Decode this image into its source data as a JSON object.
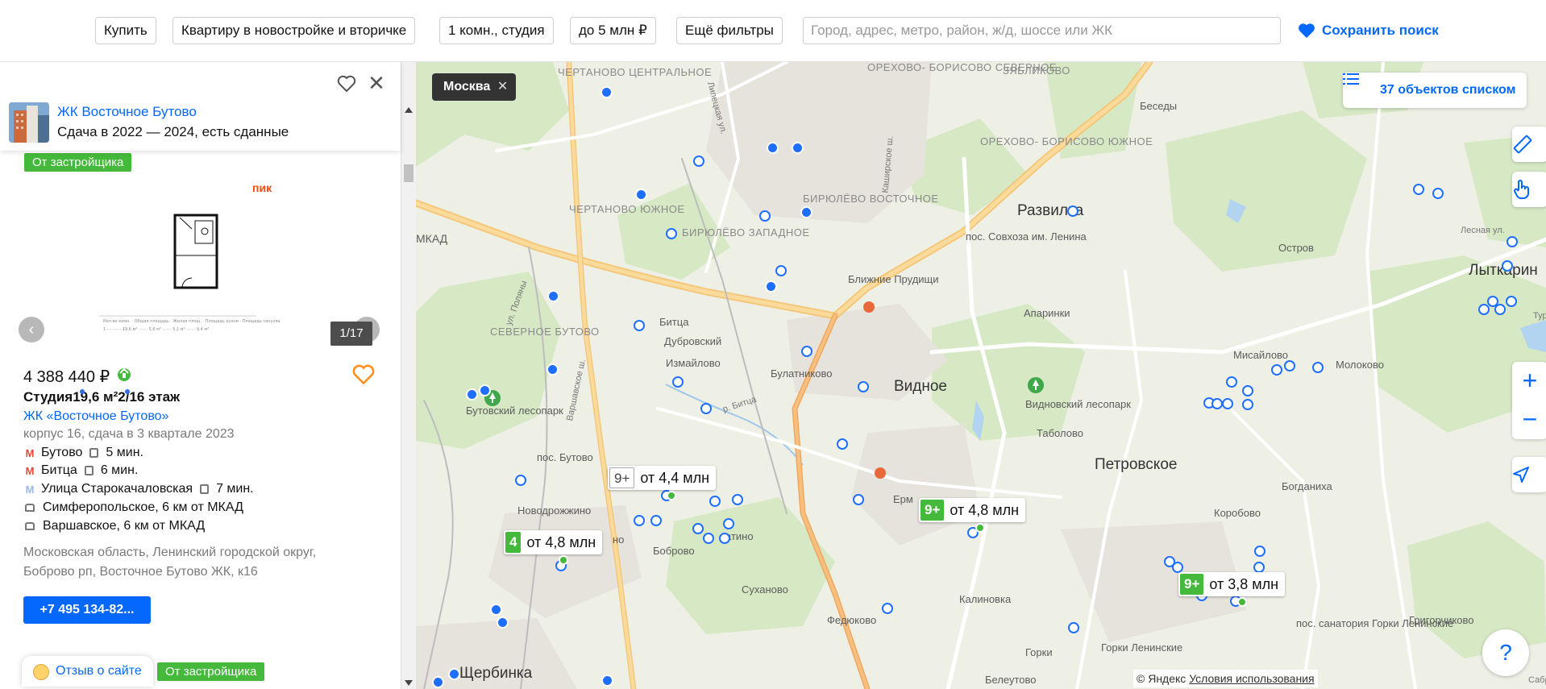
{
  "filters": {
    "buy": "Купить",
    "type": "Квартиру в новостройке и вторичке",
    "rooms": "1 комн., студия",
    "price": "до 5 млн ₽",
    "more": "Ещё фильтры",
    "search_placeholder": "Город, адрес, метро, район, ж/д, шоссе или ЖК",
    "save_search": "Сохранить поиск"
  },
  "complex": {
    "name": "ЖК Восточное Бутово",
    "deadline": "Сдача в 2022 — 2024, есть сданные"
  },
  "offer": {
    "badge": "От застройщика",
    "developer_logo": "пик",
    "photo_counter": "1/17",
    "price": "4 388 440 ₽",
    "rooms": "Студия",
    "area": "19,6 м²",
    "floor": "2/16 этаж",
    "jk": "ЖК «Восточное Бутово»",
    "building": "корпус 16, сдача в 3 квартале 2023",
    "locations": [
      {
        "kind": "metro",
        "color": "#e4463a",
        "name": "Бутово",
        "time": "5 мин.",
        "transport": "bus"
      },
      {
        "kind": "metro",
        "color": "#e4463a",
        "name": "Битца",
        "time": "6 мин.",
        "transport": "bus"
      },
      {
        "kind": "metro",
        "color": "#9bb7e6",
        "name": "Улица Старокачаловская",
        "time": "7 мин.",
        "transport": "bus"
      },
      {
        "kind": "road",
        "name": "Симферопольское, 6 км от МКАД"
      },
      {
        "kind": "road",
        "name": "Варшавское, 6 км от МКАД"
      }
    ],
    "address": "Московская область, Ленинский городской округ, Боброво рп, Восточное Бутово ЖК, к16",
    "phone": "+7 495 134-82..."
  },
  "next_offer_badge": "От застройщика",
  "feedback": "Отзыв о сайте",
  "map": {
    "city_chip": "Москва",
    "list_button": "37 объектов списком",
    "zoom_in": "+",
    "zoom_out": "−",
    "help": "?",
    "copyright_prefix": "© Яндекс",
    "copyright_link": "Условия использования",
    "places": {
      "chertanovo_c": "ЧЕРТАНОВО ЦЕНТРАЛЬНОЕ",
      "chertanovo_s": "ЧЕРТАНОВО ЮЖНОЕ",
      "biryulevo_w": "БИРЮЛЁВО ЗАПАДНОЕ",
      "biryulevo_e": "БИРЮЛЁВО ВОСТОЧНОЕ",
      "orehovo_n": "ОРЕХОВО- БОРИСОВО СЕВЕРНОЕ",
      "orehovo_s": "ОРЕХОВО- БОРИСОВО ЮЖНОЕ",
      "zyablikovo": "ЗЯБЛИКОВО",
      "severnoe_butovo": "СЕВЕРНОЕ БУТОВО",
      "butovsky_park": "Бутовский лесопарк",
      "bitsa": "Битца",
      "dubrovsky": "Дубровский",
      "izmaylovo": "Измайлово",
      "bulatnikovo": "Булатниково",
      "vidnoe": "Видное",
      "vidnovsky_park": "Видновский лесопарк",
      "tabolovo": "Таболово",
      "razvilka": "Развилка",
      "sovhoz": "пос. Совхоза им. Ленина",
      "blizhnie": "Ближние Прудищи",
      "aparinki": "Апаринки",
      "besedy": "Беседы",
      "ostrov": "Остров",
      "lytkarino": "Лыткарин",
      "misaylovo": "Мисайлово",
      "molokovo": "Молоково",
      "petrovskoe": "Петровское",
      "boganiha": "Богданиха",
      "korobovo": "Коробово",
      "pos_butovo": "пос. Бутово",
      "novodrozhzhino": "Новодрожжино",
      "bobrovo": "Боброво",
      "suhanovo": "Суханово",
      "fedyukovo": "Федюково",
      "kalinovka": "Калиновка",
      "gorki": "Горки",
      "gorki_len": "Горки Ленинские",
      "pos_sanatoriya": "пос. санатория Горки Ленинские",
      "grigorchikovo": "Григорчиково",
      "belеutovo": "Белеутово",
      "shcherbinka": "Щербинка",
      "lesnaya": "Лесная ул.",
      "tura": "Тура",
      "sayrap": "Сабра",
      "varsh": "Варшавское ш.",
      "kashir": "Каширское ш.",
      "lipetsk": "Липецкая ул.",
      "bitsa_river": "р. Битца",
      "mkad": "МКАД",
      "erm": "Ерм",
      "latino": "атино",
      "no": "но",
      "polyany": "ул. Поляны"
    },
    "clusters": [
      {
        "count": "9+",
        "label": "от 4,4 млн",
        "style": "white"
      },
      {
        "count": "9+",
        "label": "от 4,8 млн",
        "style": "green"
      },
      {
        "count": "4",
        "label": "от 4,8 млн",
        "style": "green"
      },
      {
        "count": "9+",
        "label": "от 3,8 млн",
        "style": "green"
      }
    ]
  },
  "colors": {
    "accent": "#0468ff",
    "green": "#44b93b",
    "orange_heart": "#ff8f1f"
  }
}
